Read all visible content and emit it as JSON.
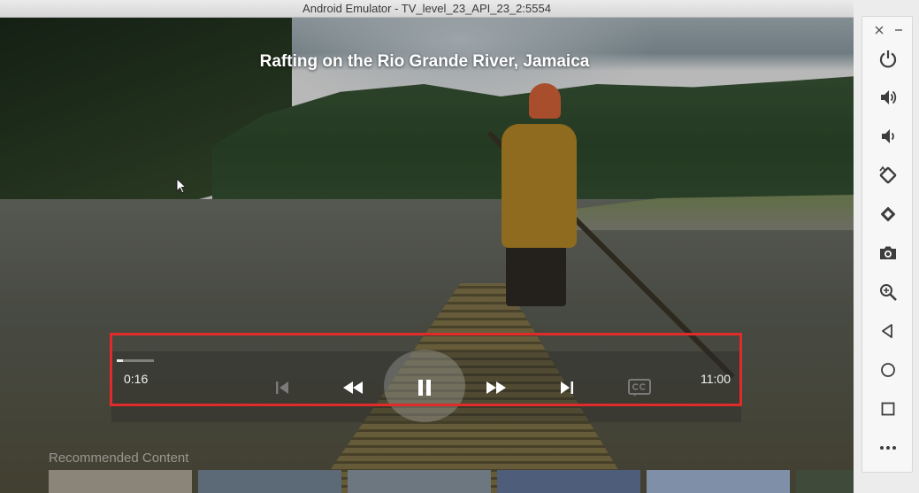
{
  "window": {
    "title": "Android Emulator - TV_level_23_API_23_2:5554"
  },
  "video": {
    "title": "Rafting on the Rio Grande River, Jamaica"
  },
  "playback": {
    "current_time": "0:16",
    "total_time": "11:00",
    "progress_fraction": 0.024,
    "state": "playing"
  },
  "controls": [
    {
      "name": "skip-previous",
      "icon": "skip-previous-icon",
      "enabled": false
    },
    {
      "name": "rewind",
      "icon": "rewind-icon",
      "enabled": true
    },
    {
      "name": "play-pause",
      "icon": "pause-icon",
      "enabled": true,
      "focused": true
    },
    {
      "name": "fast-forward",
      "icon": "fast-forward-icon",
      "enabled": true
    },
    {
      "name": "skip-next",
      "icon": "skip-next-icon",
      "enabled": true
    },
    {
      "name": "closed-captions",
      "icon": "closed-captions-icon",
      "enabled": false
    }
  ],
  "recommended": {
    "label": "Recommended Content"
  },
  "toolbar": {
    "buttons": [
      {
        "name": "power",
        "icon": "power-icon"
      },
      {
        "name": "volume-up",
        "icon": "volume-up-icon"
      },
      {
        "name": "volume-down",
        "icon": "volume-down-icon"
      },
      {
        "name": "rotate-left",
        "icon": "rotate-left-icon"
      },
      {
        "name": "rotate-right",
        "icon": "rotate-right-icon"
      },
      {
        "name": "screenshot",
        "icon": "camera-icon"
      },
      {
        "name": "zoom",
        "icon": "zoom-icon"
      },
      {
        "name": "back",
        "icon": "back-icon"
      },
      {
        "name": "home",
        "icon": "home-icon"
      },
      {
        "name": "overview",
        "icon": "overview-icon"
      },
      {
        "name": "more",
        "icon": "more-icon"
      }
    ]
  },
  "colors": {
    "highlight": "#e12a2a",
    "toolbar_icon": "#3d3d3d"
  }
}
